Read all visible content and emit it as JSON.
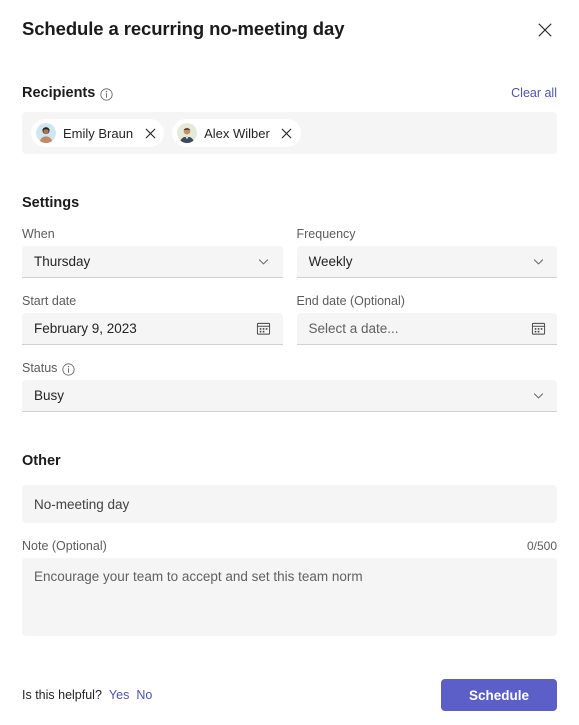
{
  "dialog": {
    "title": "Schedule a recurring no-meeting day",
    "close_icon": "close-icon"
  },
  "recipients": {
    "label": "Recipients",
    "info_icon": "info-icon",
    "clear_all_label": "Clear all",
    "items": [
      {
        "name": "Emily Braun",
        "avatar": "photo-avatar",
        "remove_icon": "close-icon"
      },
      {
        "name": "Alex Wilber",
        "avatar": "photo-avatar",
        "remove_icon": "close-icon"
      }
    ]
  },
  "settings": {
    "title": "Settings",
    "when": {
      "label": "When",
      "value": "Thursday",
      "chevron_icon": "chevron-down-icon"
    },
    "frequency": {
      "label": "Frequency",
      "value": "Weekly",
      "chevron_icon": "chevron-down-icon"
    },
    "start_date": {
      "label": "Start date",
      "value": "February 9, 2023",
      "calendar_icon": "calendar-icon"
    },
    "end_date": {
      "label": "End date (Optional)",
      "placeholder": "Select a date...",
      "calendar_icon": "calendar-icon"
    },
    "status": {
      "label": "Status",
      "info_icon": "info-icon",
      "value": "Busy",
      "chevron_icon": "chevron-down-icon"
    }
  },
  "other": {
    "title": "Other",
    "subject": {
      "value": "No-meeting day"
    },
    "note": {
      "label": "Note (Optional)",
      "counter": "0/500",
      "placeholder": "Encourage your team to accept and set this team norm"
    }
  },
  "footer": {
    "feedback_question": "Is this helpful?",
    "yes_label": "Yes",
    "no_label": "No",
    "submit_label": "Schedule"
  },
  "colors": {
    "accent": "#5b5fc7",
    "link": "#4f52b2",
    "field_bg": "#f5f5f5",
    "text": "#242424"
  }
}
